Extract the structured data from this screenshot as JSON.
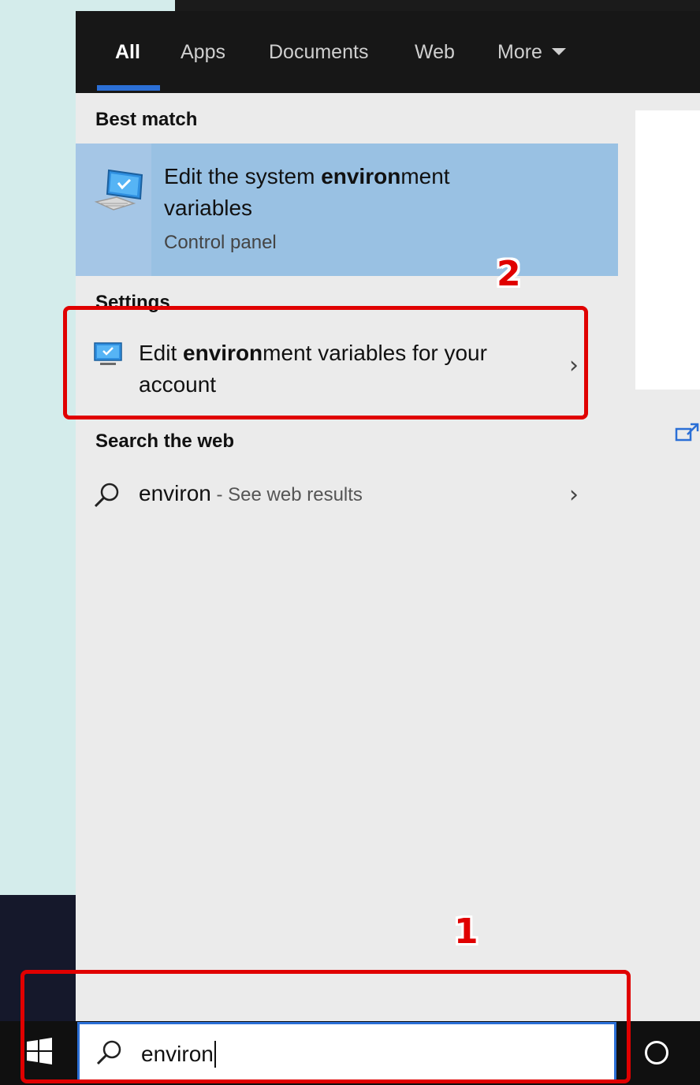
{
  "tabs": [
    {
      "label": "All"
    },
    {
      "label": "Apps"
    },
    {
      "label": "Documents"
    },
    {
      "label": "Web"
    },
    {
      "label": "More"
    }
  ],
  "best_match": {
    "heading": "Best match",
    "title_pre": "Edit the system ",
    "title_bold": "environ",
    "title_post": "ment variables",
    "subtitle": "Control panel",
    "icon": "computer-monitor-icon"
  },
  "settings": {
    "heading": "Settings",
    "title_pre": "Edit ",
    "title_bold": "environ",
    "title_post": "ment variables for your account",
    "icon": "monitor-settings-icon"
  },
  "web": {
    "heading": "Search the web",
    "query": "environ",
    "suffix": " - See web results",
    "icon": "search-icon"
  },
  "search_box": {
    "value": "environ",
    "icon": "search-icon"
  },
  "annotations": [
    {
      "number": "1",
      "color": "#e00000"
    },
    {
      "number": "2",
      "color": "#e00000"
    }
  ],
  "colors": {
    "accent": "#2b6fd6",
    "selected_bg": "#99c1e3",
    "tab_bar": "#171717"
  }
}
